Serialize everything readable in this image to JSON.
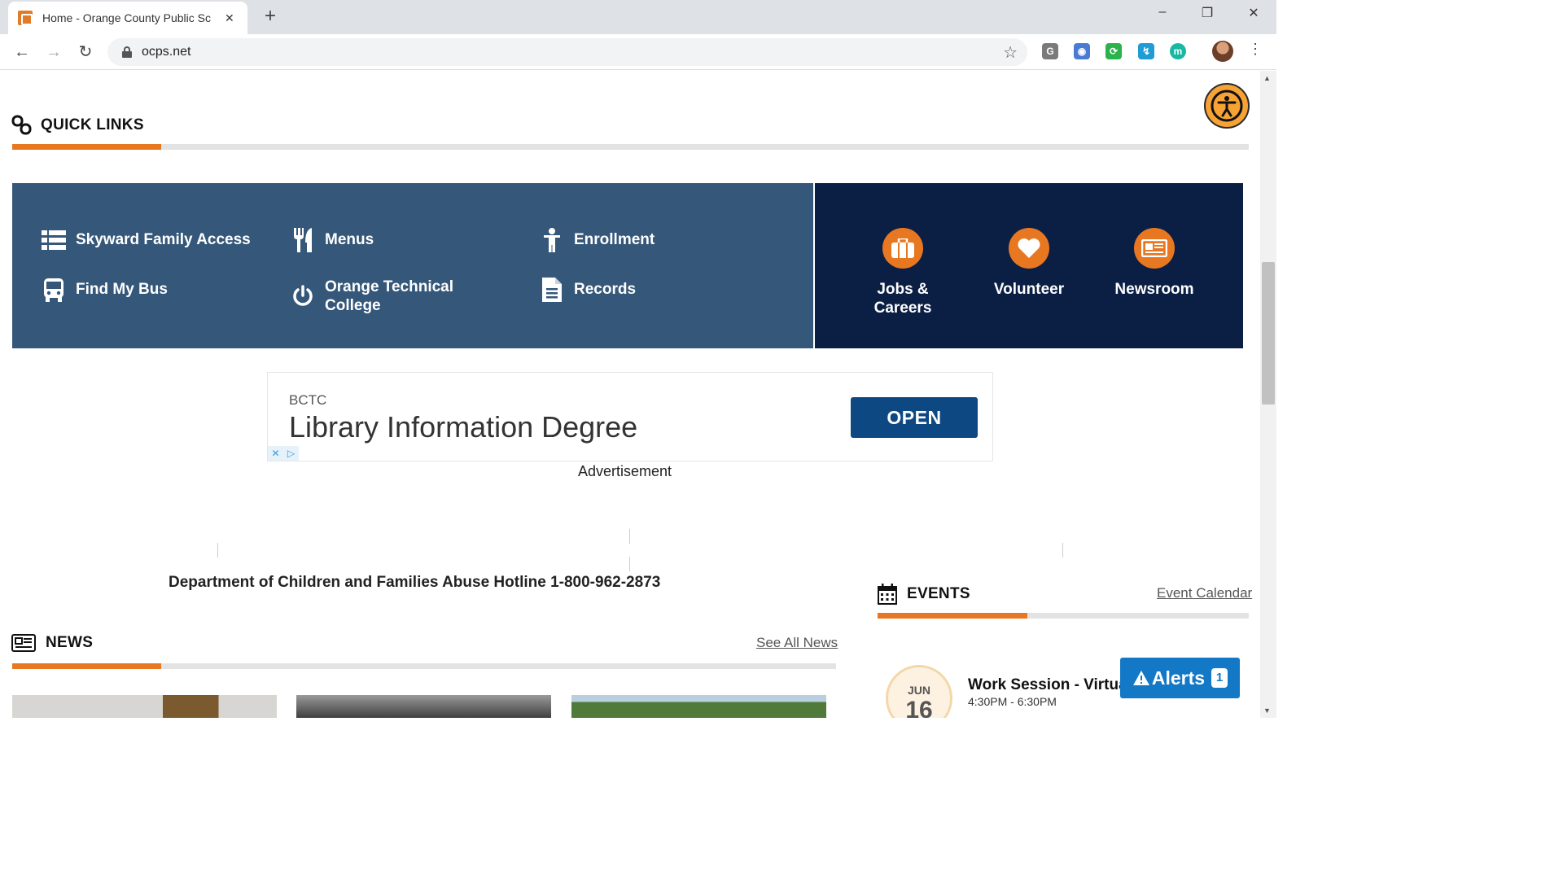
{
  "browser": {
    "tab_title": "Home - Orange County Public Sc",
    "url": "ocps.net",
    "window_controls": [
      "–",
      "❐",
      "✕"
    ],
    "new_tab": "+",
    "extensions": [
      {
        "name": "g-extension",
        "label": "G",
        "color": "#7a7a7a"
      },
      {
        "name": "camera-extension",
        "label": "◉",
        "color": "#4a7bd4"
      },
      {
        "name": "sync-extension",
        "label": "⟳",
        "color": "#2bb24c"
      },
      {
        "name": "blocked-extension",
        "label": "↯",
        "color": "#1f9bd6"
      },
      {
        "name": "m-extension",
        "label": "m",
        "color": "#18b8a3"
      }
    ]
  },
  "quick_links": {
    "title": "QUICK LINKS",
    "items": [
      {
        "label": "Skyward Family Access",
        "icon": "list-icon"
      },
      {
        "label": "Menus",
        "icon": "utensils-icon"
      },
      {
        "label": "Enrollment",
        "icon": "child-icon"
      },
      {
        "label": "Find My Bus",
        "icon": "bus-icon"
      },
      {
        "label": "Orange Technical College",
        "icon": "power-icon"
      },
      {
        "label": "Records",
        "icon": "document-icon"
      }
    ],
    "featured": [
      {
        "label": "Jobs & Careers",
        "icon": "briefcase-icon"
      },
      {
        "label": "Volunteer",
        "icon": "heart-icon"
      },
      {
        "label": "Newsroom",
        "icon": "newspaper-icon"
      }
    ]
  },
  "ad": {
    "brand": "BCTC",
    "headline": "Library Information Degree",
    "cta": "OPEN",
    "label": "Advertisement",
    "choice_close": "✕",
    "choice_play": "▷"
  },
  "hotline": "Department of Children and Families Abuse Hotline 1-800-962-2873",
  "news": {
    "title": "NEWS",
    "see_all": "See All News"
  },
  "events": {
    "title": "EVENTS",
    "calendar_link": "Event Calendar",
    "items": [
      {
        "month": "JUN",
        "day": "16",
        "title": "Work Session - Virtual",
        "time": "4:30PM - 6:30PM"
      }
    ]
  },
  "alerts": {
    "label": "Alerts",
    "count": "1"
  },
  "colors": {
    "accent": "#e87722",
    "ql_blue": "#355779",
    "ql_navy": "#0b1f45",
    "alerts_blue": "#1379c6"
  }
}
